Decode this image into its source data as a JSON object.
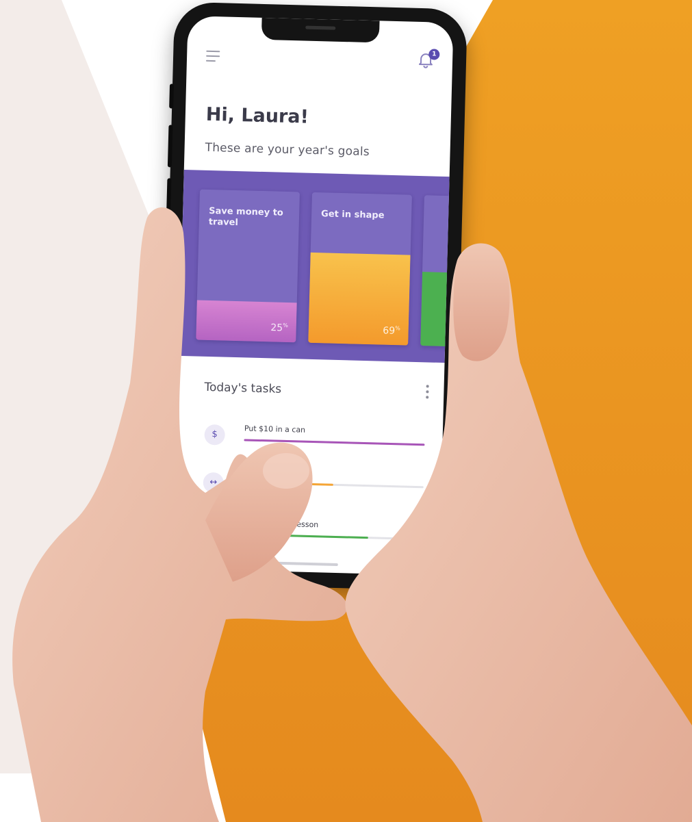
{
  "colors": {
    "accent_purple": "#6e5ab5",
    "card_purple": "#7c6bc0",
    "orange_bg": "#ec9520",
    "pink_fill": "#c46fc4",
    "orange_fill": "#f5a535",
    "green_bar": "#4caf50"
  },
  "header": {
    "menu_icon": "hamburger-menu-icon",
    "bell_icon": "bell-icon",
    "notification_count": "1"
  },
  "greeting": "Hi, Laura!",
  "subtitle": "These are your year's goals",
  "goals": [
    {
      "title": "Save money to travel",
      "percent": "25",
      "percent_suffix": "%",
      "progress": 0.25
    },
    {
      "title": "Get in shape",
      "percent": "69",
      "percent_suffix": "%",
      "progress": 0.69
    }
  ],
  "tasks": {
    "title": "Today's tasks",
    "more_icon": "vertical-dots-icon",
    "items": [
      {
        "icon": "coin-icon",
        "label": "Put $10 in a can",
        "progress": 1.0
      },
      {
        "icon": "dumbbell-icon",
        "label": "",
        "progress": 0.5
      },
      {
        "icon": "music-icon",
        "label": "...ing lesson",
        "progress": 0.7
      }
    ]
  }
}
